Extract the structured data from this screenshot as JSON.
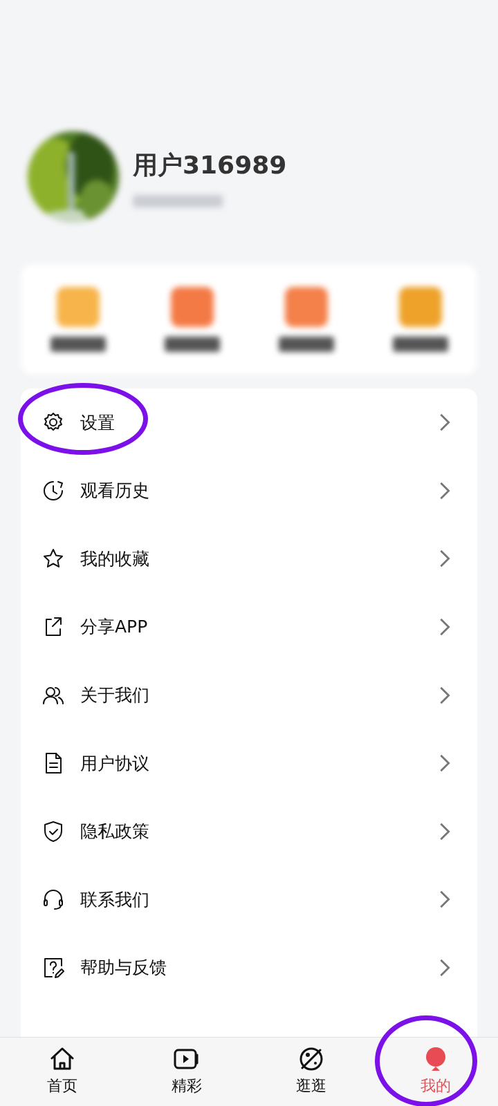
{
  "profile": {
    "username": "用户316989"
  },
  "quick_actions": [
    {
      "color": "#f7b44a"
    },
    {
      "color": "#f47a45"
    },
    {
      "color": "#f4804a"
    },
    {
      "color": "#eea22a"
    }
  ],
  "menu": [
    {
      "label": "设置",
      "highlighted": true
    },
    {
      "label": "观看历史",
      "highlighted": false
    },
    {
      "label": "我的收藏",
      "highlighted": false
    },
    {
      "label": "分享APP",
      "highlighted": false
    },
    {
      "label": "关于我们",
      "highlighted": false
    },
    {
      "label": "用户协议",
      "highlighted": false
    },
    {
      "label": "隐私政策",
      "highlighted": false
    },
    {
      "label": "联系我们",
      "highlighted": false
    },
    {
      "label": "帮助与反馈",
      "highlighted": false
    }
  ],
  "tab_bar": [
    {
      "label": "首页",
      "selected": false,
      "highlighted": false
    },
    {
      "label": "精彩",
      "selected": false,
      "highlighted": false
    },
    {
      "label": "逛逛",
      "selected": false,
      "highlighted": false
    },
    {
      "label": "我的",
      "selected": true,
      "highlighted": true
    }
  ]
}
